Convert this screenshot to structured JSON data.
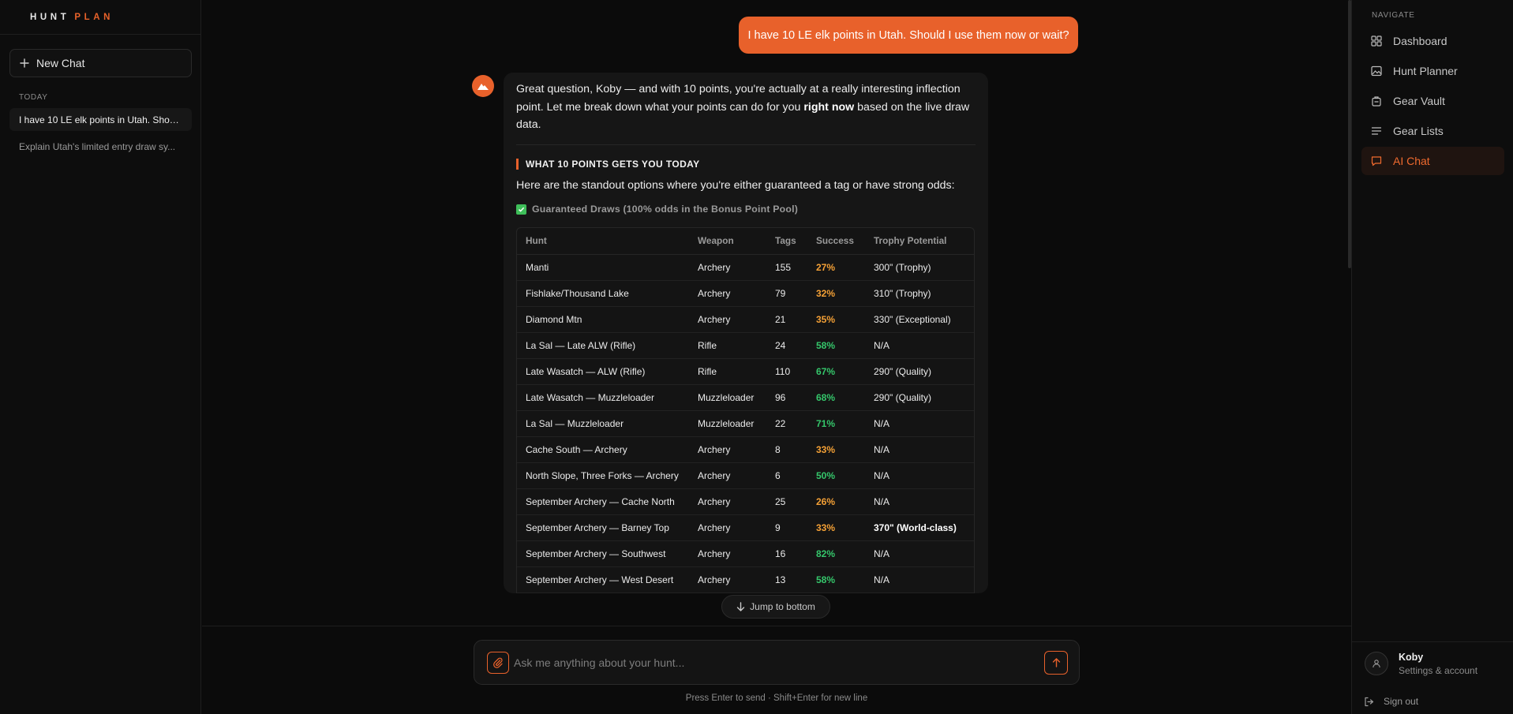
{
  "brand": {
    "word1": "HUNT",
    "word2": "PLAN"
  },
  "left_sidebar": {
    "new_chat_label": "New Chat",
    "section_label": "TODAY",
    "chats": [
      {
        "title": "I have 10 LE elk points in Utah. Shoul..."
      },
      {
        "title": "Explain Utah's limited entry draw sy..."
      }
    ]
  },
  "conversation": {
    "user_message": "I have 10 LE elk points in Utah. Should I use them now or wait?",
    "assistant": {
      "intro_part1": "Great question, Koby — and with 10 points, you're actually at a really interesting inflection point. Let me break down what your points can do for you ",
      "intro_bold": "right now",
      "intro_part2": " based on the live draw data.",
      "section_heading": "WHAT 10 POINTS GETS YOU TODAY",
      "paragraph": "Here are the standout options where you're either guaranteed a tag or have strong odds:",
      "guaranteed_label": "Guaranteed Draws (100% odds in the Bonus Point Pool)",
      "table": {
        "headers": [
          "Hunt",
          "Weapon",
          "Tags",
          "Success",
          "Trophy Potential"
        ],
        "rows": [
          {
            "hunt": "Manti",
            "weapon": "Archery",
            "tags": "155",
            "success": "27%",
            "success_level": "orange",
            "trophy": "300\" (Trophy)",
            "trophy_bold": false
          },
          {
            "hunt": "Fishlake/Thousand Lake",
            "weapon": "Archery",
            "tags": "79",
            "success": "32%",
            "success_level": "orange",
            "trophy": "310\" (Trophy)",
            "trophy_bold": false
          },
          {
            "hunt": "Diamond Mtn",
            "weapon": "Archery",
            "tags": "21",
            "success": "35%",
            "success_level": "orange",
            "trophy": "330\" (Exceptional)",
            "trophy_bold": false
          },
          {
            "hunt": "La Sal — Late ALW (Rifle)",
            "weapon": "Rifle",
            "tags": "24",
            "success": "58%",
            "success_level": "green",
            "trophy": "N/A",
            "trophy_bold": false
          },
          {
            "hunt": "Late Wasatch — ALW (Rifle)",
            "weapon": "Rifle",
            "tags": "110",
            "success": "67%",
            "success_level": "green",
            "trophy": "290\" (Quality)",
            "trophy_bold": false
          },
          {
            "hunt": "Late Wasatch — Muzzleloader",
            "weapon": "Muzzleloader",
            "tags": "96",
            "success": "68%",
            "success_level": "green",
            "trophy": "290\" (Quality)",
            "trophy_bold": false
          },
          {
            "hunt": "La Sal — Muzzleloader",
            "weapon": "Muzzleloader",
            "tags": "22",
            "success": "71%",
            "success_level": "green",
            "trophy": "N/A",
            "trophy_bold": false
          },
          {
            "hunt": "Cache South — Archery",
            "weapon": "Archery",
            "tags": "8",
            "success": "33%",
            "success_level": "orange",
            "trophy": "N/A",
            "trophy_bold": false
          },
          {
            "hunt": "North Slope, Three Forks — Archery",
            "weapon": "Archery",
            "tags": "6",
            "success": "50%",
            "success_level": "green",
            "trophy": "N/A",
            "trophy_bold": false
          },
          {
            "hunt": "September Archery — Cache North",
            "weapon": "Archery",
            "tags": "25",
            "success": "26%",
            "success_level": "orange",
            "trophy": "N/A",
            "trophy_bold": false
          },
          {
            "hunt": "September Archery — Barney Top",
            "weapon": "Archery",
            "tags": "9",
            "success": "33%",
            "success_level": "orange",
            "trophy": "370\" (World-class)",
            "trophy_bold": true
          },
          {
            "hunt": "September Archery — Southwest",
            "weapon": "Archery",
            "tags": "16",
            "success": "82%",
            "success_level": "green",
            "trophy": "N/A",
            "trophy_bold": false
          },
          {
            "hunt": "September Archery — West Desert",
            "weapon": "Archery",
            "tags": "13",
            "success": "58%",
            "success_level": "green",
            "trophy": "N/A",
            "trophy_bold": false
          }
        ]
      }
    },
    "jump_to_bottom_label": "Jump to bottom"
  },
  "composer": {
    "placeholder": "Ask me anything about your hunt...",
    "hint": "Press Enter to send · Shift+Enter for new line"
  },
  "right_sidebar": {
    "nav_label": "NAVIGATE",
    "items": [
      {
        "label": "Dashboard",
        "icon": "dashboard-icon",
        "active": false
      },
      {
        "label": "Hunt Planner",
        "icon": "map-icon",
        "active": false
      },
      {
        "label": "Gear Vault",
        "icon": "backpack-icon",
        "active": false
      },
      {
        "label": "Gear Lists",
        "icon": "list-icon",
        "active": false
      },
      {
        "label": "AI Chat",
        "icon": "chat-icon",
        "active": true
      }
    ],
    "profile": {
      "name": "Koby",
      "subtitle": "Settings & account"
    },
    "sign_out_label": "Sign out"
  },
  "colors": {
    "accent": "#e8612b",
    "success_orange": "#f5a136",
    "success_green": "#35c76b",
    "background": "#0b0b0b"
  }
}
